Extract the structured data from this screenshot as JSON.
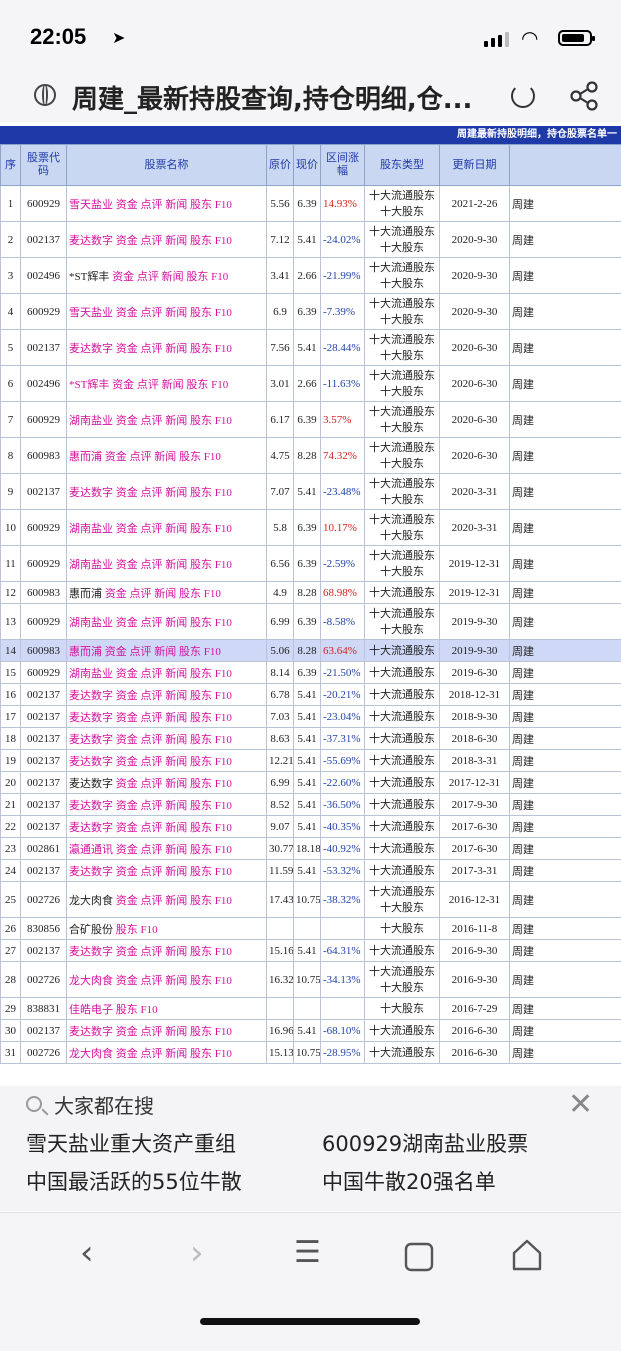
{
  "status": {
    "time": "22:05"
  },
  "browser": {
    "title": "周建_最新持股查询,持仓明细,仓..."
  },
  "banner": "周建最新持股明细，持仓股票名单一",
  "columns": [
    "序",
    "股票代码",
    "股票名称",
    "原价",
    "现价",
    "区间涨幅",
    "股东类型",
    "更新日期",
    ""
  ],
  "link_labels": {
    "funds": "资金",
    "review": "点评",
    "news": "新闻",
    "holders": "股东",
    "f10": "F10"
  },
  "rows": [
    {
      "no": "1",
      "code": "600929",
      "name": "雪天盐业",
      "orig": "5.56",
      "now": "6.39",
      "chg": "14.93%",
      "type": "十大流通股东 十大股东",
      "date": "2021-2-26",
      "who": "周建"
    },
    {
      "no": "2",
      "code": "002137",
      "name": "麦达数字",
      "orig": "7.12",
      "now": "5.41",
      "chg": "-24.02%",
      "type": "十大流通股东 十大股东",
      "date": "2020-9-30",
      "who": "周建"
    },
    {
      "no": "3",
      "code": "002496",
      "name": "*ST辉丰",
      "orig": "3.41",
      "now": "2.66",
      "chg": "-21.99%",
      "type": "十大流通股东 十大股东",
      "date": "2020-9-30",
      "who": "周建"
    },
    {
      "no": "4",
      "code": "600929",
      "name": "雪天盐业",
      "orig": "6.9",
      "now": "6.39",
      "chg": "-7.39%",
      "type": "十大流通股东 十大股东",
      "date": "2020-9-30",
      "who": "周建"
    },
    {
      "no": "5",
      "code": "002137",
      "name": "麦达数字",
      "orig": "7.56",
      "now": "5.41",
      "chg": "-28.44%",
      "type": "十大流通股东 十大股东",
      "date": "2020-6-30",
      "who": "周建"
    },
    {
      "no": "6",
      "code": "002496",
      "name": "*ST辉丰",
      "orig": "3.01",
      "now": "2.66",
      "chg": "-11.63%",
      "type": "十大流通股东 十大股东",
      "date": "2020-6-30",
      "who": "周建"
    },
    {
      "no": "7",
      "code": "600929",
      "name": "湖南盐业",
      "orig": "6.17",
      "now": "6.39",
      "chg": "3.57%",
      "type": "十大流通股东 十大股东",
      "date": "2020-6-30",
      "who": "周建"
    },
    {
      "no": "8",
      "code": "600983",
      "name": "惠而浦",
      "orig": "4.75",
      "now": "8.28",
      "chg": "74.32%",
      "type": "十大流通股东 十大股东",
      "date": "2020-6-30",
      "who": "周建"
    },
    {
      "no": "9",
      "code": "002137",
      "name": "麦达数字",
      "orig": "7.07",
      "now": "5.41",
      "chg": "-23.48%",
      "type": "十大流通股东 十大股东",
      "date": "2020-3-31",
      "who": "周建"
    },
    {
      "no": "10",
      "code": "600929",
      "name": "湖南盐业",
      "orig": "5.8",
      "now": "6.39",
      "chg": "10.17%",
      "type": "十大流通股东 十大股东",
      "date": "2020-3-31",
      "who": "周建"
    },
    {
      "no": "11",
      "code": "600929",
      "name": "湖南盐业",
      "orig": "6.56",
      "now": "6.39",
      "chg": "-2.59%",
      "type": "十大流通股东 十大股东",
      "date": "2019-12-31",
      "who": "周建"
    },
    {
      "no": "12",
      "code": "600983",
      "name": "惠而浦",
      "orig": "4.9",
      "now": "8.28",
      "chg": "68.98%",
      "type": "十大流通股东",
      "date": "2019-12-31",
      "who": "周建"
    },
    {
      "no": "13",
      "code": "600929",
      "name": "湖南盐业",
      "orig": "6.99",
      "now": "6.39",
      "chg": "-8.58%",
      "type": "十大流通股东 十大股东",
      "date": "2019-9-30",
      "who": "周建"
    },
    {
      "no": "14",
      "code": "600983",
      "name": "惠而浦",
      "orig": "5.06",
      "now": "8.28",
      "chg": "63.64%",
      "type": "十大流通股东",
      "date": "2019-9-30",
      "who": "周建"
    },
    {
      "no": "15",
      "code": "600929",
      "name": "湖南盐业",
      "orig": "8.14",
      "now": "6.39",
      "chg": "-21.50%",
      "type": "十大流通股东",
      "date": "2019-6-30",
      "who": "周建"
    },
    {
      "no": "16",
      "code": "002137",
      "name": "麦达数字",
      "orig": "6.78",
      "now": "5.41",
      "chg": "-20.21%",
      "type": "十大流通股东",
      "date": "2018-12-31",
      "who": "周建"
    },
    {
      "no": "17",
      "code": "002137",
      "name": "麦达数字",
      "orig": "7.03",
      "now": "5.41",
      "chg": "-23.04%",
      "type": "十大流通股东",
      "date": "2018-9-30",
      "who": "周建"
    },
    {
      "no": "18",
      "code": "002137",
      "name": "麦达数字",
      "orig": "8.63",
      "now": "5.41",
      "chg": "-37.31%",
      "type": "十大流通股东",
      "date": "2018-6-30",
      "who": "周建"
    },
    {
      "no": "19",
      "code": "002137",
      "name": "麦达数字",
      "orig": "12.21",
      "now": "5.41",
      "chg": "-55.69%",
      "type": "十大流通股东",
      "date": "2018-3-31",
      "who": "周建"
    },
    {
      "no": "20",
      "code": "002137",
      "name": "麦达数字",
      "orig": "6.99",
      "now": "5.41",
      "chg": "-22.60%",
      "type": "十大流通股东",
      "date": "2017-12-31",
      "who": "周建"
    },
    {
      "no": "21",
      "code": "002137",
      "name": "麦达数字",
      "orig": "8.52",
      "now": "5.41",
      "chg": "-36.50%",
      "type": "十大流通股东",
      "date": "2017-9-30",
      "who": "周建"
    },
    {
      "no": "22",
      "code": "002137",
      "name": "麦达数字",
      "orig": "9.07",
      "now": "5.41",
      "chg": "-40.35%",
      "type": "十大流通股东",
      "date": "2017-6-30",
      "who": "周建"
    },
    {
      "no": "23",
      "code": "002861",
      "name": "瀛通通讯",
      "orig": "30.77",
      "now": "18.18",
      "chg": "-40.92%",
      "type": "十大流通股东",
      "date": "2017-6-30",
      "who": "周建"
    },
    {
      "no": "24",
      "code": "002137",
      "name": "麦达数字",
      "orig": "11.59",
      "now": "5.41",
      "chg": "-53.32%",
      "type": "十大流通股东",
      "date": "2017-3-31",
      "who": "周建"
    },
    {
      "no": "25",
      "code": "002726",
      "name": "龙大肉食",
      "orig": "17.43",
      "now": "10.75",
      "chg": "-38.32%",
      "type": "十大流通股东 十大股东",
      "date": "2016-12-31",
      "who": "周建"
    },
    {
      "no": "26",
      "code": "830856",
      "name": "合矿股份",
      "orig": "",
      "now": "",
      "chg": "",
      "type": "十大股东",
      "date": "2016-11-8",
      "who": "周建",
      "short": true
    },
    {
      "no": "27",
      "code": "002137",
      "name": "麦达数字",
      "orig": "15.16",
      "now": "5.41",
      "chg": "-64.31%",
      "type": "十大流通股东",
      "date": "2016-9-30",
      "who": "周建"
    },
    {
      "no": "28",
      "code": "002726",
      "name": "龙大肉食",
      "orig": "16.32",
      "now": "10.75",
      "chg": "-34.13%",
      "type": "十大流通股东 十大股东",
      "date": "2016-9-30",
      "who": "周建"
    },
    {
      "no": "29",
      "code": "838831",
      "name": "佳皓电子",
      "orig": "",
      "now": "",
      "chg": "",
      "type": "十大股东",
      "date": "2016-7-29",
      "who": "周建",
      "short": true
    },
    {
      "no": "30",
      "code": "002137",
      "name": "麦达数字",
      "orig": "16.96",
      "now": "5.41",
      "chg": "-68.10%",
      "type": "十大流通股东",
      "date": "2016-6-30",
      "who": "周建"
    },
    {
      "no": "31",
      "code": "002726",
      "name": "龙大肉食",
      "orig": "15.13",
      "now": "10.75",
      "chg": "-28.95%",
      "type": "十大流通股东",
      "date": "2016-6-30",
      "who": "周建"
    }
  ],
  "search": {
    "heading": "大家都在搜",
    "suggestions": [
      "雪天盐业重大资产重组",
      "600929湖南盐业股票",
      "中国最活跃的55位牛散",
      "中国牛散20强名单"
    ]
  }
}
